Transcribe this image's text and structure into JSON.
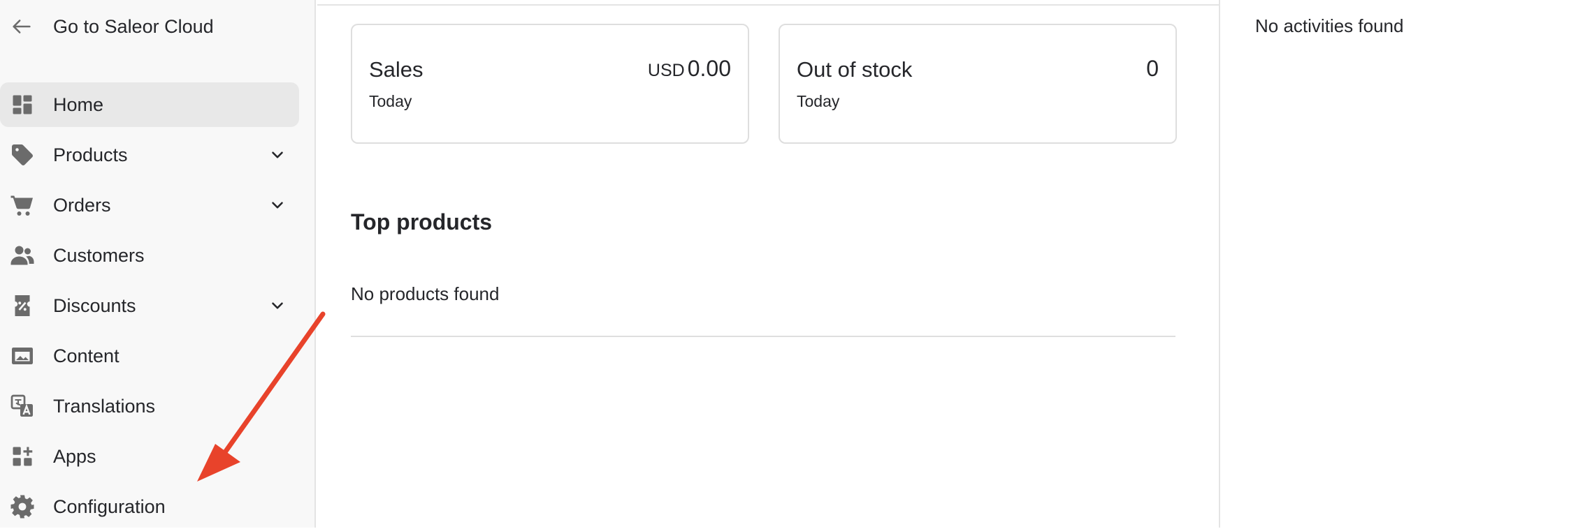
{
  "sidebar": {
    "back_label": "Go to Saleor Cloud",
    "items": [
      {
        "label": "Home",
        "icon": "dashboard-icon",
        "active": true,
        "expandable": false
      },
      {
        "label": "Products",
        "icon": "tag-icon",
        "active": false,
        "expandable": true
      },
      {
        "label": "Orders",
        "icon": "cart-icon",
        "active": false,
        "expandable": true
      },
      {
        "label": "Customers",
        "icon": "users-icon",
        "active": false,
        "expandable": false
      },
      {
        "label": "Discounts",
        "icon": "discount-ticket-icon",
        "active": false,
        "expandable": true
      },
      {
        "label": "Content",
        "icon": "content-icon",
        "active": false,
        "expandable": false
      },
      {
        "label": "Translations",
        "icon": "translate-icon",
        "active": false,
        "expandable": false
      },
      {
        "label": "Apps",
        "icon": "apps-grid-plus-icon",
        "active": false,
        "expandable": false
      },
      {
        "label": "Configuration",
        "icon": "gear-icon",
        "active": false,
        "expandable": false
      }
    ]
  },
  "main": {
    "cards": [
      {
        "title": "Sales",
        "subtitle": "Today",
        "currency": "USD",
        "value": "0.00"
      },
      {
        "title": "Out of stock",
        "subtitle": "Today",
        "currency": "",
        "value": "0"
      }
    ],
    "top_products": {
      "title": "Top products",
      "empty_text": "No products found"
    }
  },
  "activity": {
    "empty_text": "No activities found"
  },
  "colors": {
    "annotation_arrow": "#e8432b",
    "sidebar_bg": "#f8f8f8",
    "active_item_bg": "#e8e8e8",
    "icon_gray": "#6b6b6b"
  }
}
